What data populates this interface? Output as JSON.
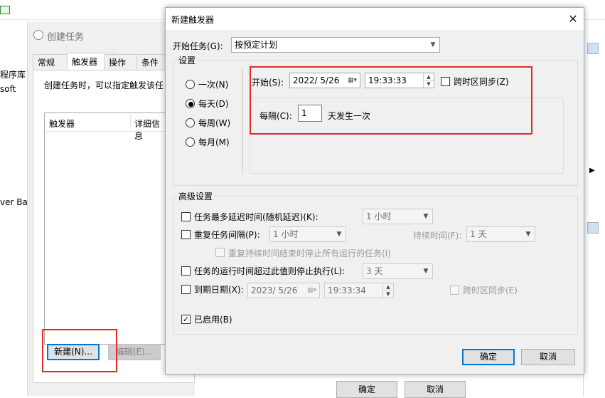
{
  "background": {
    "left_labels": [
      "程序库",
      "soft",
      "ver Ba"
    ],
    "window_title": "创建任务",
    "tabs": [
      "常规",
      "触发器",
      "操作",
      "条件"
    ],
    "description": "创建任务时，可以指定触发该任",
    "trigger_list_columns": [
      "触发器",
      "详细信息"
    ],
    "new_button": "新建(N)...",
    "edit_button": "编辑(E)...",
    "bottom_ok": "确定",
    "bottom_cancel": "取消"
  },
  "dialog": {
    "title": "新建触发器",
    "close_glyph": "✕",
    "begin_task_label": "开始任务(G):",
    "begin_task_value": "按预定计划",
    "settings_group": "设置",
    "schedule_options": [
      "一次(N)",
      "每天(D)",
      "每周(W)",
      "每月(M)"
    ],
    "selected_schedule": "每天(D)",
    "start_label": "开始(S):",
    "start_date": "2022/  5/26",
    "start_time": "19:33:33",
    "sync_timezone_label": "跨时区同步(Z)",
    "recur_label": "每隔(C):",
    "recur_value": "1",
    "recur_suffix": "天发生一次",
    "advanced_group": "高级设置",
    "delay_label": "任务最多延迟时间(随机延迟)(K):",
    "delay_value": "1 小时",
    "repeat_label": "重复任务间隔(P):",
    "repeat_value": "1 小时",
    "duration_label": "持续时间(F):",
    "duration_value": "1 天",
    "stop_all_label": "重复持续时间结束时停止所有运行的任务(I)",
    "stop_if_label": "任务的运行时间超过此值则停止执行(L):",
    "stop_if_value": "3 天",
    "expire_label": "到期日期(X):",
    "expire_date": "2023/  5/26",
    "expire_time": "19:33:34",
    "expire_sync_label": "跨时区同步(E)",
    "enabled_label": "已启用(B)",
    "ok_button": "确定",
    "cancel_button": "取消"
  },
  "colors": {
    "highlight_red": "#e32b2b",
    "primary_border": "#0078d7",
    "dialog_bg": "#f0f0f0"
  }
}
